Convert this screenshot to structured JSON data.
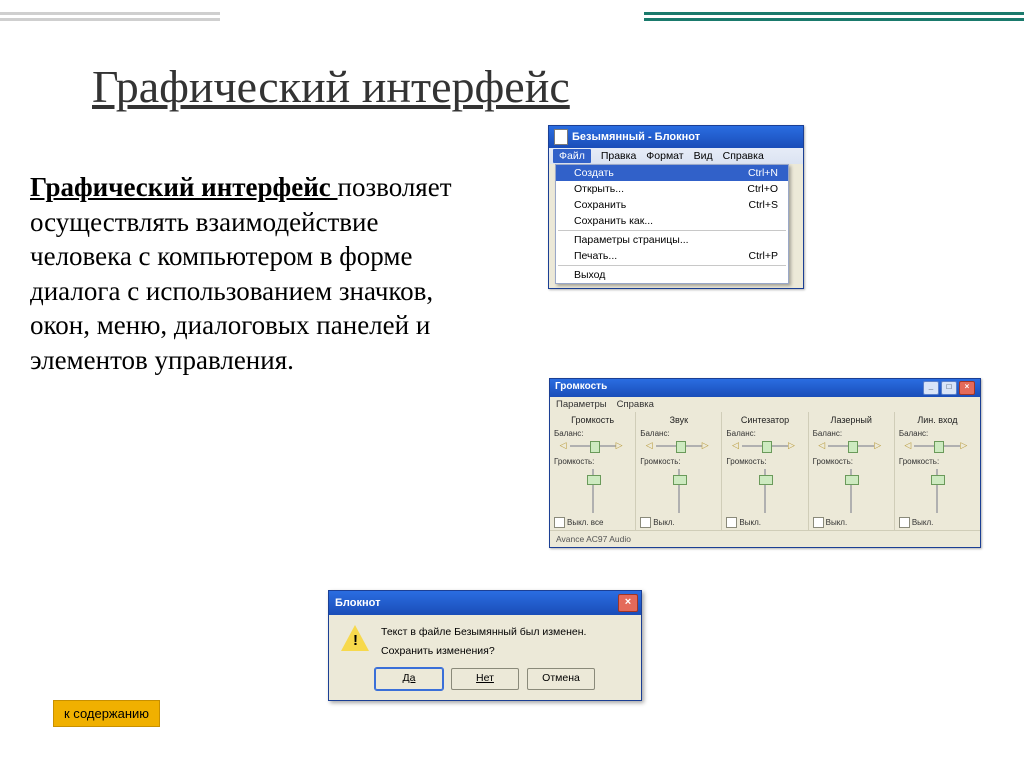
{
  "slide": {
    "title": "Графический интерфейс",
    "body_bold": "Графический интерфейс ",
    "body_rest": "позволяет осуществлять взаимодействие человека с компьютером в форме диалога с использованием значков, окон, меню, диалоговых панелей и элементов управления.",
    "toc_label": "к содержанию"
  },
  "notepad": {
    "title": "Безымянный - Блокнот",
    "menubar": [
      "Файл",
      "Правка",
      "Формат",
      "Вид",
      "Справка"
    ],
    "menu_items": [
      {
        "label": "Создать",
        "shortcut": "Ctrl+N",
        "selected": true
      },
      {
        "label": "Открыть...",
        "shortcut": "Ctrl+O"
      },
      {
        "label": "Сохранить",
        "shortcut": "Ctrl+S"
      },
      {
        "label": "Сохранить как...",
        "shortcut": ""
      },
      {
        "sep": true
      },
      {
        "label": "Параметры страницы...",
        "shortcut": ""
      },
      {
        "label": "Печать...",
        "shortcut": "Ctrl+P"
      },
      {
        "sep": true
      },
      {
        "label": "Выход",
        "shortcut": ""
      }
    ]
  },
  "mixer": {
    "title": "Громкость",
    "menubar": [
      "Параметры",
      "Справка"
    ],
    "balance_label": "Баланс:",
    "volume_label": "Громкость:",
    "footer": "Avance AC97 Audio",
    "channels": [
      {
        "name": "Громкость",
        "mute": "Выкл. все"
      },
      {
        "name": "Звук",
        "mute": "Выкл."
      },
      {
        "name": "Синтезатор",
        "mute": "Выкл."
      },
      {
        "name": "Лазерный",
        "mute": "Выкл."
      },
      {
        "name": "Лин. вход",
        "mute": "Выкл."
      }
    ]
  },
  "dialog": {
    "title": "Блокнот",
    "line1": "Текст в файле Безымянный был изменен.",
    "line2": "Сохранить изменения?",
    "btn_yes": "Да",
    "btn_no": "Нет",
    "btn_cancel": "Отмена"
  }
}
